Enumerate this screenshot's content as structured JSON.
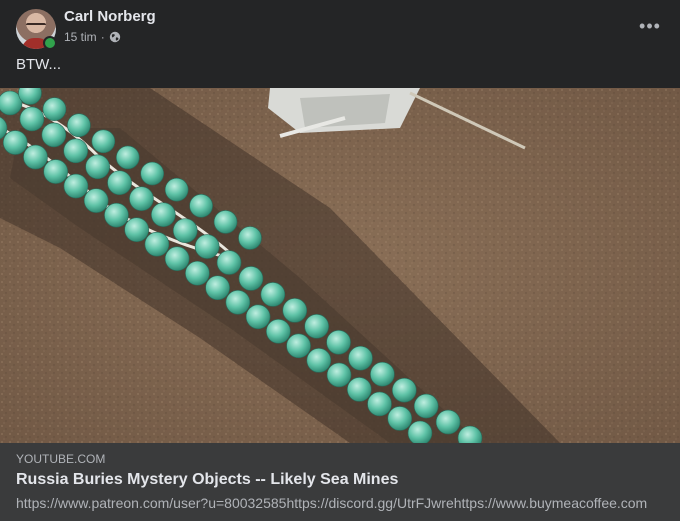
{
  "post": {
    "author": "Carl Norberg",
    "time": "15 tim",
    "separator": "·",
    "privacy_icon": "globe-icon",
    "more_icon": "ellipsis-icon",
    "more_label": "•••",
    "text": "BTW..."
  },
  "media": {
    "description_icon": "photo"
  },
  "link_preview": {
    "domain": "YOUTUBE.COM",
    "title": "Russia Buries Mystery Objects -- Likely Sea Mines",
    "description": "https://www.patreon.com/user?u=80032585https://discord.gg/UtrFJwrehttps://www.buymeacoffee.com"
  },
  "colors": {
    "background": "#242526",
    "preview_background": "#3a3b3c",
    "primary_text": "#e4e6eb",
    "secondary_text": "#b0b3b8",
    "online": "#31a24c"
  }
}
